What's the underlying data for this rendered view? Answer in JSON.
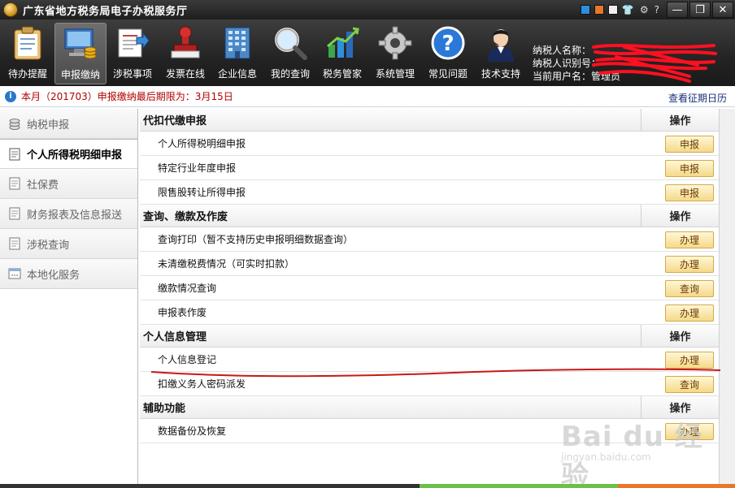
{
  "window": {
    "title": "广东省地方税务局电子办税服务厅",
    "controls": {
      "minimize": "—",
      "restore": "❐",
      "close": "✕"
    },
    "tray_glyphs": [
      "👕",
      "⚙",
      "?"
    ]
  },
  "toolbar": {
    "items": [
      {
        "label": "待办提醒",
        "icon": "clipboard-icon"
      },
      {
        "label": "申报缴纳",
        "icon": "computer-coins-icon",
        "active": true
      },
      {
        "label": "涉税事项",
        "icon": "document-arrow-icon"
      },
      {
        "label": "发票在线",
        "icon": "stamp-icon"
      },
      {
        "label": "企业信息",
        "icon": "building-icon"
      },
      {
        "label": "我的查询",
        "icon": "magnifier-icon"
      },
      {
        "label": "税务管家",
        "icon": "bar-chart-icon"
      },
      {
        "label": "系统管理",
        "icon": "gear-icon"
      },
      {
        "label": "常见问题",
        "icon": "help-icon"
      },
      {
        "label": "技术支持",
        "icon": "support-agent-icon"
      }
    ]
  },
  "user": {
    "name_label": "纳税人名称：",
    "id_label": "纳税人识别号：",
    "account_label": "当前用户名：",
    "account_value": "管理员"
  },
  "notice": {
    "message": "本月（201703）申报缴纳最后期限为：3月15日",
    "calendar_link": "查看征期日历"
  },
  "sidebar": {
    "items": [
      {
        "label": "纳税申报",
        "icon": "database-icon"
      },
      {
        "label": "个人所得税明细申报",
        "icon": "document-icon",
        "active": true
      },
      {
        "label": "社保费",
        "icon": "document-icon"
      },
      {
        "label": "财务报表及信息报送",
        "icon": "document-icon"
      },
      {
        "label": "涉税查询",
        "icon": "document-icon"
      },
      {
        "label": "本地化服务",
        "icon": "window-icon"
      }
    ]
  },
  "main": {
    "sections": [
      {
        "title": "代扣代缴申报",
        "op_header": "操作",
        "rows": [
          {
            "label": "个人所得税明细申报",
            "action": "申报"
          },
          {
            "label": "特定行业年度申报",
            "action": "申报"
          },
          {
            "label": "限售股转让所得申报",
            "action": "申报"
          }
        ]
      },
      {
        "title": "查询、缴款及作废",
        "op_header": "操作",
        "rows": [
          {
            "label": "查询打印（暂不支持历史申报明细数据查询）",
            "action": "办理"
          },
          {
            "label": "未清缴税费情况（可实时扣款）",
            "action": "办理"
          },
          {
            "label": "缴款情况查询",
            "action": "查询"
          },
          {
            "label": "申报表作废",
            "action": "办理"
          }
        ]
      },
      {
        "title": "个人信息管理",
        "op_header": "操作",
        "rows": [
          {
            "label": "个人信息登记",
            "action": "办理"
          },
          {
            "label": "扣缴义务人密码派发",
            "action": "查询"
          }
        ]
      },
      {
        "title": "辅助功能",
        "op_header": "操作",
        "rows": [
          {
            "label": "数据备份及恢复",
            "action": "办理"
          }
        ]
      }
    ]
  },
  "watermark": {
    "line1": "Bai du 经验",
    "line2": "jingyan.baidu.com"
  },
  "colors": {
    "accent_red": "#b00000",
    "button_bg": "#f5d98a",
    "button_border": "#d6a948",
    "status_green": "#6cc04a",
    "status_orange": "#e8772a"
  }
}
